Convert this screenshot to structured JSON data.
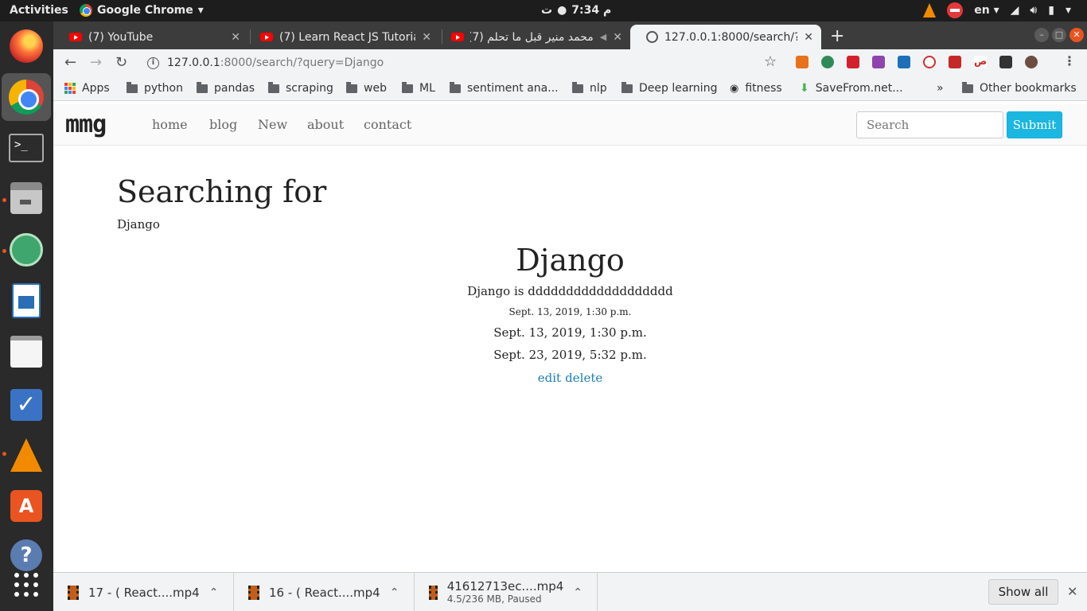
{
  "topbar": {
    "activities": "Activities",
    "app_name": "Google Chrome",
    "clock_time": "7:34 م",
    "clock_day": "ت",
    "lang": "en"
  },
  "tabs": [
    {
      "title": "(7) YouTube"
    },
    {
      "title": "(7) Learn React JS Tutorial"
    },
    {
      "title": "محمد منير قبل ما تحلم (7)"
    },
    {
      "title": "127.0.0.1:8000/search/?query=Django"
    }
  ],
  "toolbar": {
    "url_host": "127.0.0.1",
    "url_path": ":8000/search/?query=Django"
  },
  "bookmarks": [
    {
      "label": "Apps"
    },
    {
      "label": "python"
    },
    {
      "label": "pandas"
    },
    {
      "label": "scraping"
    },
    {
      "label": "web"
    },
    {
      "label": "ML"
    },
    {
      "label": "sentiment ana..."
    },
    {
      "label": "nlp"
    },
    {
      "label": "Deep learning"
    },
    {
      "label": "fitness"
    },
    {
      "label": "SaveFrom.net..."
    },
    {
      "label": "»"
    },
    {
      "label": "Other bookmarks"
    }
  ],
  "site": {
    "brand": "mmg",
    "nav": [
      {
        "label": "home"
      },
      {
        "label": "blog"
      },
      {
        "label": "New"
      },
      {
        "label": "about"
      },
      {
        "label": "contact"
      }
    ],
    "search_placeholder": "Search",
    "submit_label": "Submit"
  },
  "main": {
    "heading": "Searching for",
    "query": "Django",
    "post": {
      "title": "Django",
      "body": "Django is ddddddddddddddddddd",
      "date_small": "Sept. 13, 2019, 1:30 p.m.",
      "date_created": "Sept. 13, 2019, 1:30 p.m.",
      "date_updated": "Sept. 23, 2019, 5:32 p.m.",
      "edit_label": "edit",
      "delete_label": "delete"
    }
  },
  "downloads": {
    "items": [
      {
        "name": "17 - ( React....mp4",
        "sub": ""
      },
      {
        "name": "16 - ( React....mp4",
        "sub": ""
      },
      {
        "name": "41612713ec....mp4",
        "sub": "4.5/236 MB, Paused"
      }
    ],
    "show_all": "Show all"
  }
}
